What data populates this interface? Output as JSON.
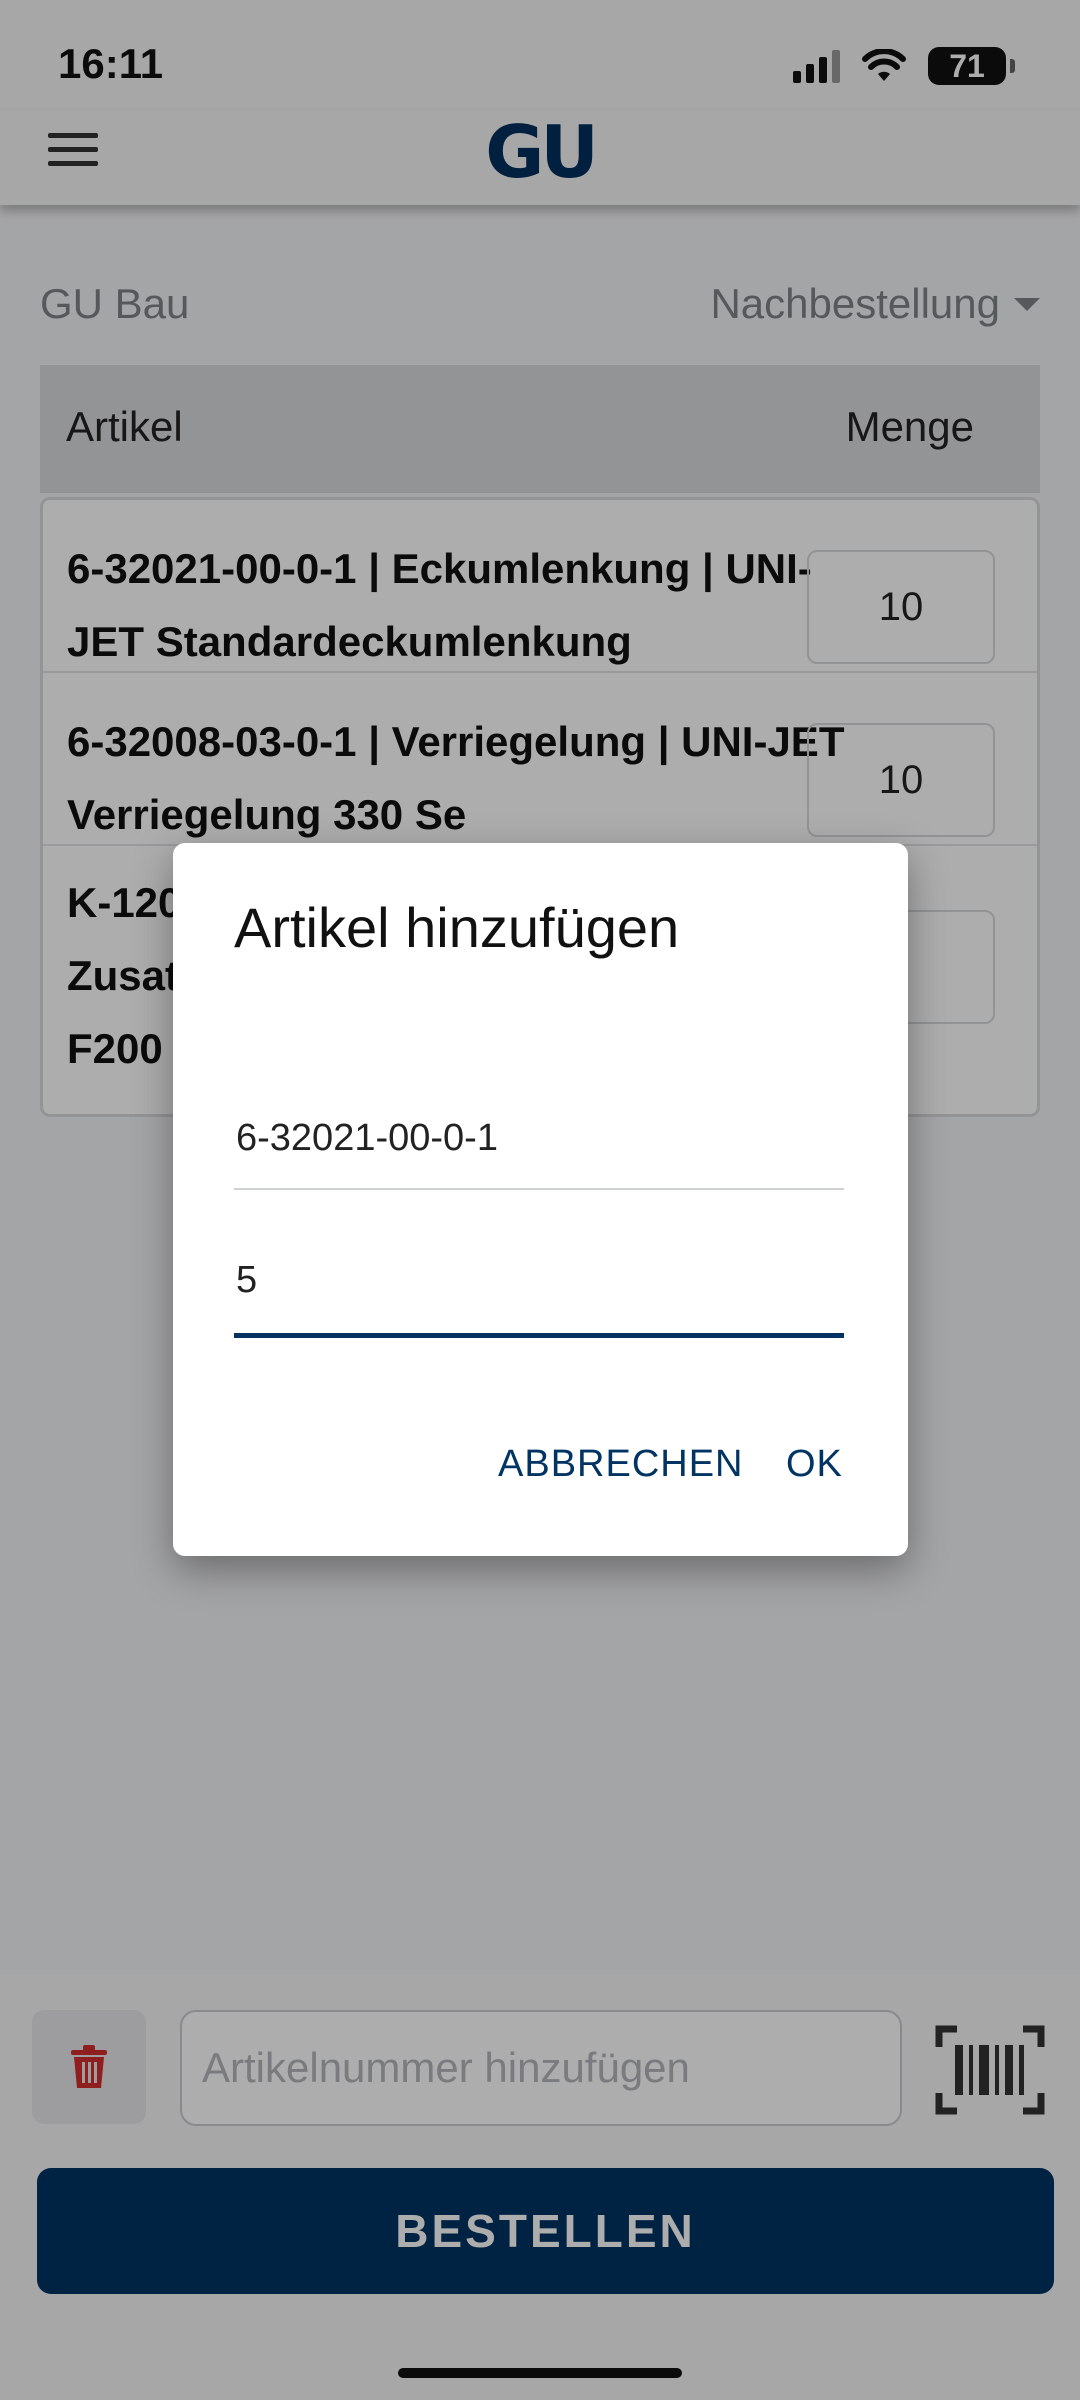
{
  "status_bar": {
    "time": "16:11",
    "battery": "71"
  },
  "header": {
    "logo": "GU",
    "menu_icon": "hamburger-menu-icon"
  },
  "context": {
    "company": "GU Bau",
    "order_type": "Nachbestellung"
  },
  "table": {
    "columns": {
      "article": "Artikel",
      "quantity": "Menge"
    },
    "rows": [
      {
        "text": "6-32021-00-0-1 | Eckumlenkung | UNI-JET Standardeckumlenkung",
        "qty": "10"
      },
      {
        "text": "6-32008-03-0-1 | Verriegelung | UNI-JET Verriegelung 330 Se",
        "qty": "10"
      },
      {
        "text": "K-120 Zusat F200",
        "qty": ""
      }
    ]
  },
  "dialog": {
    "title": "Artikel hinzufügen",
    "article_value": "6-32021-00-0-1",
    "quantity_value": "5",
    "cancel_label": "ABBRECHEN",
    "ok_label": "OK"
  },
  "bottom": {
    "article_placeholder": "Artikelnummer hinzufügen",
    "order_label": "BESTELLEN",
    "delete_icon": "trash-icon",
    "scan_icon": "barcode-icon"
  },
  "colors": {
    "brand": "#023463",
    "delete": "#d32f2f"
  }
}
